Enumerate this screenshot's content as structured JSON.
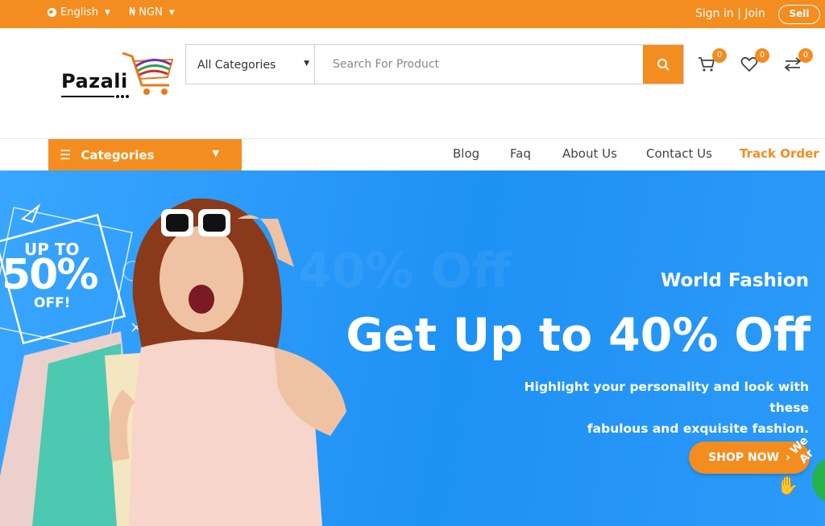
{
  "topbar": {
    "language": "English",
    "currency_symbol": "₦",
    "currency": "NGN",
    "signin": "Sign in | Join",
    "sell": "Sell"
  },
  "header": {
    "logo_text": "Pazali",
    "search": {
      "category": "All Categories",
      "placeholder": "Search For Product"
    },
    "cart_count": "0",
    "wishlist_count": "0",
    "compare_count": "0"
  },
  "nav": {
    "categories": "Categories",
    "links": [
      "Blog",
      "Faq",
      "About Us",
      "Contact Us"
    ],
    "track_order": "Track Order"
  },
  "hero": {
    "promo_up": "UP TO",
    "promo_pct": "50%",
    "promo_off": "OFF!",
    "subtitle": "World Fashion",
    "title": "Get Up to 40% Off",
    "desc_line1": "Highlight your personality and look with these",
    "desc_line2": "fabulous and exquisite fashion.",
    "cta": "SHOP NOW",
    "chat_text": "We Ar"
  },
  "colors": {
    "accent": "#f48d1f",
    "hero_bg": "#2b9af9"
  }
}
